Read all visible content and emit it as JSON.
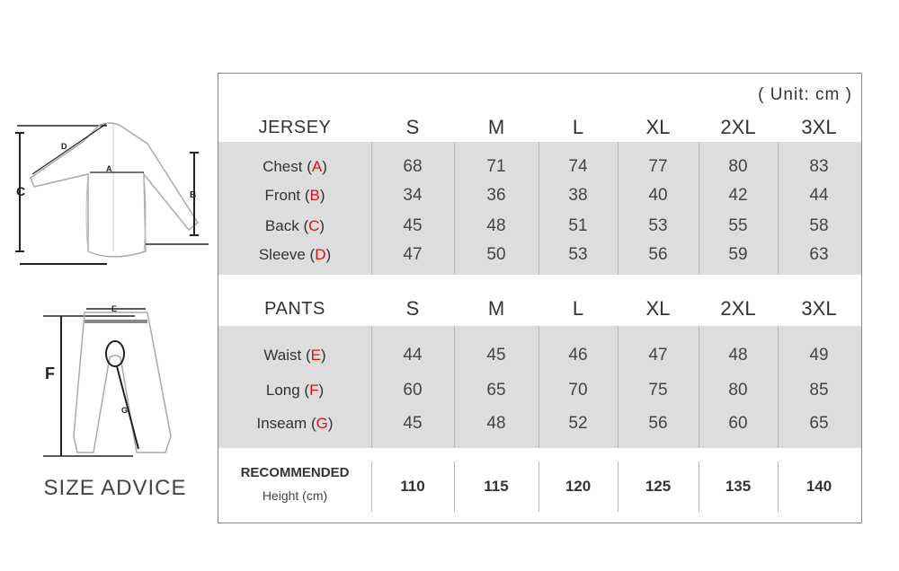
{
  "unit_note": "( Unit: cm )",
  "side_caption": "SIZE ADVICE",
  "diagram_letters": {
    "a": "A",
    "b": "B",
    "c": "C",
    "d": "D",
    "e": "E",
    "f": "F",
    "g": "G"
  },
  "sizes": [
    "S",
    "M",
    "L",
    "XL",
    "2XL",
    "3XL"
  ],
  "jersey": {
    "title": "JERSEY",
    "rows": [
      {
        "name": "Chest",
        "letter": "A",
        "values": [
          "68",
          "71",
          "74",
          "77",
          "80",
          "83"
        ]
      },
      {
        "name": "Front",
        "letter": "B",
        "values": [
          "34",
          "36",
          "38",
          "40",
          "42",
          "44"
        ]
      },
      {
        "name": "Back",
        "letter": "C",
        "values": [
          "45",
          "48",
          "51",
          "53",
          "55",
          "58"
        ]
      },
      {
        "name": "Sleeve",
        "letter": "D",
        "values": [
          "47",
          "50",
          "53",
          "56",
          "59",
          "63"
        ]
      }
    ]
  },
  "pants": {
    "title": "PANTS",
    "rows": [
      {
        "name": "Waist",
        "letter": "E",
        "values": [
          "44",
          "45",
          "46",
          "47",
          "48",
          "49"
        ]
      },
      {
        "name": "Long",
        "letter": "F",
        "values": [
          "60",
          "65",
          "70",
          "75",
          "80",
          "85"
        ]
      },
      {
        "name": "Inseam",
        "letter": "G",
        "values": [
          "45",
          "48",
          "52",
          "56",
          "60",
          "65"
        ]
      }
    ]
  },
  "recommended": {
    "title": "RECOMMENDED",
    "subtitle": "Height (cm)",
    "values": [
      "110",
      "115",
      "120",
      "125",
      "135",
      "140"
    ]
  },
  "colors": {
    "letter_accent": "#d0141b",
    "band": "#dddddd",
    "frame": "#888888"
  }
}
